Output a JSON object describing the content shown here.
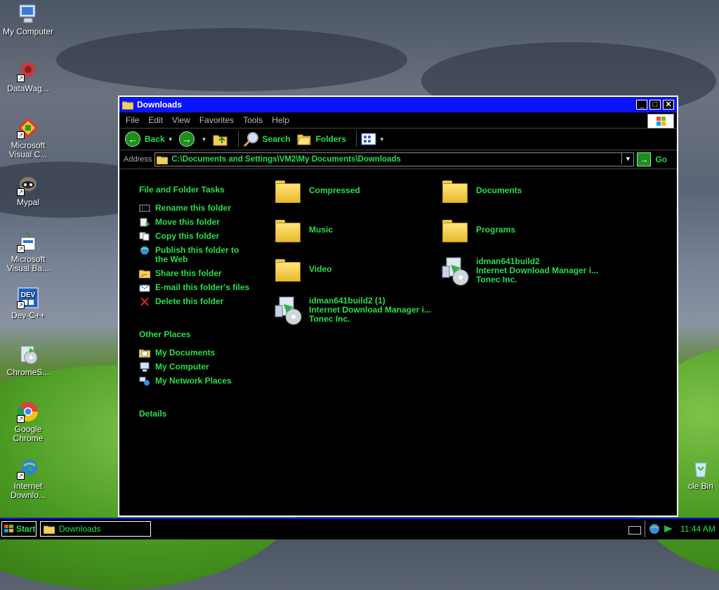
{
  "desktop": {
    "icons": [
      {
        "label": "My Computer"
      },
      {
        "label": "DataWag..."
      },
      {
        "label": "Microsoft Visual C..."
      },
      {
        "label": "Mypal"
      },
      {
        "label": "Microsoft Visual Ba..."
      },
      {
        "label": "Dev-C++"
      },
      {
        "label": "ChromeS..."
      },
      {
        "label": "Google Chrome"
      },
      {
        "label": "Internet Downlo..."
      },
      {
        "label": "cle Bin"
      }
    ]
  },
  "window": {
    "title": "Downloads",
    "menu": [
      "File",
      "Edit",
      "View",
      "Favorites",
      "Tools",
      "Help"
    ],
    "toolbar": {
      "back": "Back",
      "search": "Search",
      "folders": "Folders"
    },
    "address": {
      "label": "Address",
      "value": "C:\\Documents and Settings\\VM2\\My Documents\\Downloads",
      "go": "Go"
    },
    "tasks": {
      "heading": "File and Folder Tasks",
      "items": [
        "Rename this folder",
        "Move this folder",
        "Copy this folder",
        "Publish this folder to the Web",
        "Share this folder",
        "E-mail this folder's files",
        "Delete this folder"
      ]
    },
    "other_places": {
      "heading": "Other Places",
      "items": [
        "My Documents",
        "My Computer",
        "My Network Places"
      ]
    },
    "details": {
      "heading": "Details"
    },
    "files": [
      {
        "name": "Compressed",
        "type": "folder"
      },
      {
        "name": "Documents",
        "type": "folder"
      },
      {
        "name": "Music",
        "type": "folder"
      },
      {
        "name": "Programs",
        "type": "folder"
      },
      {
        "name": "Video",
        "type": "folder"
      },
      {
        "name": "idman641build2",
        "line2": "Internet Download Manager i...",
        "line3": "Tonec Inc.",
        "type": "installer"
      },
      {
        "name": "idman641build2 (1)",
        "line2": "Internet Download Manager i...",
        "line3": "Tonec Inc.",
        "type": "installer"
      }
    ]
  },
  "taskbar": {
    "start": "Start",
    "task": "Downloads",
    "clock": "11:44 AM"
  },
  "colors": {
    "accent": "#22e04a",
    "titlebar": "#0a14ff",
    "window_bg": "#000000"
  }
}
